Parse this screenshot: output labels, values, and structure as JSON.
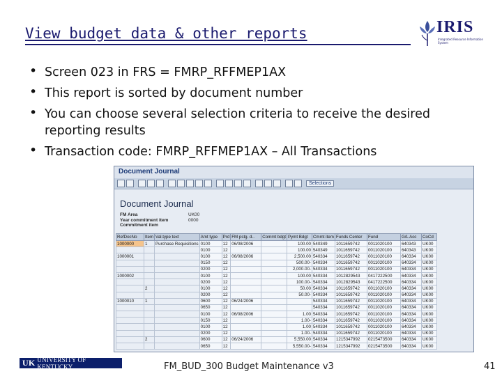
{
  "slide": {
    "title": "View budget data & other reports",
    "bullets": [
      "Screen 023 in FRS = FMRP_RFFMEP1AX",
      "This report is sorted by document number",
      "You can choose several selection criteria to receive the desired reporting results",
      "Transaction code: FMRP_RFFMEP1AX – All Transactions"
    ],
    "footer": "FM_BUD_300 Budget Maintenance v3",
    "page_number": "41",
    "logo_text": "IRIS",
    "logo_subtitle": "Integrated Resource Information System",
    "uk_logo_text": "UNIVERSITY OF KENTUCKY",
    "uk_logo_mark": "UK"
  },
  "sap": {
    "window_title": "Document Journal",
    "toolbar_selections": "Selections",
    "report_heading": "Document Journal",
    "params": [
      {
        "label": "FM Area",
        "value": "UK00"
      },
      {
        "label": "Year commitment item",
        "value": "0000"
      },
      {
        "label": "Commitment item",
        "value": ""
      }
    ],
    "columns": [
      "RefDocNo",
      "Item",
      "Val.type text",
      "Amt type",
      "Prd",
      "FM pstg. d..",
      "Commt bdgt",
      "Pymt Bdgt",
      "Cmmt item",
      "Funds Center",
      "Fund",
      "G/L Acc",
      "CoCd"
    ],
    "rows": [
      [
        "1000000",
        "1",
        "Purchase Requisitions",
        "0100",
        "12",
        "06/08/2006",
        "",
        "100.00",
        "540349",
        "1011659742",
        "0011020100",
        "640343",
        "UK00"
      ],
      [
        "",
        "",
        "",
        "0100",
        "12",
        "",
        "",
        "100.00",
        "540349",
        "1011659742",
        "0011020100",
        "640343",
        "UK00"
      ],
      [
        "1000001",
        "",
        "",
        "0100",
        "12",
        "06/08/2006",
        "",
        "2,500.00",
        "540334",
        "1011659742",
        "0011020100",
        "640334",
        "UK00"
      ],
      [
        "",
        "",
        "",
        "0150",
        "12",
        "",
        "",
        "500.00-",
        "540334",
        "1011659742",
        "0011020100",
        "640334",
        "UK00"
      ],
      [
        "",
        "",
        "",
        "0200",
        "12",
        "",
        "",
        "2,000.00-",
        "540334",
        "1011659742",
        "0011020100",
        "640334",
        "UK00"
      ],
      [
        "1000002",
        "",
        "",
        "0100",
        "12",
        "",
        "",
        "100.00",
        "540334",
        "1012829543",
        "0417222500",
        "640334",
        "UK00"
      ],
      [
        "",
        "",
        "",
        "0200",
        "12",
        "",
        "",
        "100.00-",
        "540334",
        "1012829543",
        "0417222500",
        "640334",
        "UK00"
      ],
      [
        "",
        "2",
        "",
        "0100",
        "12",
        "",
        "",
        "50.00",
        "540334",
        "1011659742",
        "0011020100",
        "640334",
        "UK00"
      ],
      [
        "",
        "",
        "",
        "0200",
        "12",
        "",
        "",
        "50.00-",
        "540334",
        "1011659742",
        "0011020100",
        "640334",
        "UK00"
      ],
      [
        "1000010",
        "1",
        "",
        "0600",
        "12",
        "06/24/2006",
        "",
        "",
        "540334",
        "1011659742",
        "0011020100",
        "640334",
        "UK00"
      ],
      [
        "",
        "",
        "",
        "0650",
        "12",
        "",
        "",
        "",
        "540334",
        "1011659742",
        "0011020100",
        "640334",
        "UK00"
      ],
      [
        "",
        "",
        "",
        "0100",
        "12",
        "06/08/2006",
        "",
        "1.00",
        "540334",
        "1011659742",
        "0011020100",
        "640334",
        "UK00"
      ],
      [
        "",
        "",
        "",
        "0150",
        "12",
        "",
        "",
        "1.00-",
        "540334",
        "1011659742",
        "0011020100",
        "640334",
        "UK00"
      ],
      [
        "",
        "",
        "",
        "0100",
        "12",
        "",
        "",
        "1.00",
        "540334",
        "1011659742",
        "0011020100",
        "640334",
        "UK00"
      ],
      [
        "",
        "",
        "",
        "0200",
        "12",
        "",
        "",
        "1.00-",
        "540334",
        "1011659742",
        "0011020100",
        "640334",
        "UK00"
      ],
      [
        "",
        "2",
        "",
        "0600",
        "12",
        "06/24/2006",
        "",
        "5,550.00",
        "540334",
        "1215347992",
        "0215473500",
        "640334",
        "UK00"
      ],
      [
        "",
        "",
        "",
        "0650",
        "12",
        "",
        "",
        "5,550.00-",
        "540334",
        "1215347992",
        "0215473500",
        "640334",
        "UK00"
      ]
    ]
  }
}
